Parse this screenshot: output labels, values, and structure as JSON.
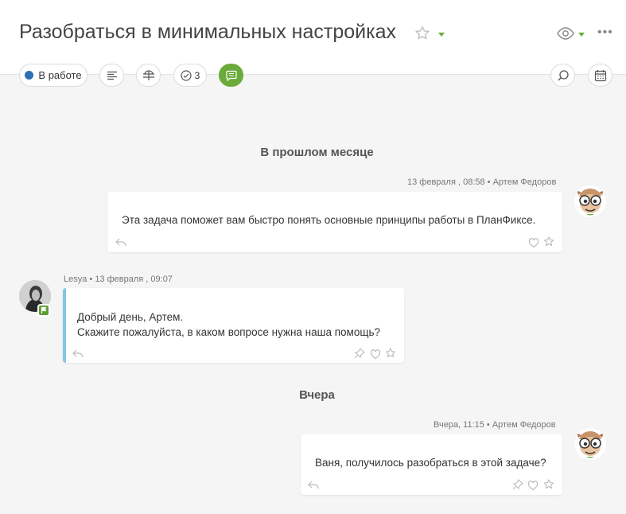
{
  "header": {
    "title": "Разобраться в минимальных настройках",
    "status_label": "В работе",
    "status_color": "#2f6db5",
    "checklist_count": "3",
    "accent_color": "#6aab3a",
    "icons": [
      "star-icon",
      "chevron-down-icon",
      "eye-icon",
      "more-icon",
      "description-icon",
      "fields-icon",
      "checklist-icon",
      "comments-icon",
      "search-icon",
      "calendar-icon"
    ]
  },
  "feed": {
    "groups": [
      {
        "label": "В прошлом месяце",
        "messages": [
          {
            "meta": "13 февраля , 08:58 • Артем Федоров",
            "lines": [
              "Эта задача поможет вам быстро понять основные принципы работы в ПланФиксе."
            ]
          },
          {
            "meta": "Lesya • 13 февраля , 09:07",
            "lines": [
              "Добрый день, Артем.",
              "Скажите пожалуйста, в каком вопросе нужна наша помощь?"
            ]
          }
        ]
      },
      {
        "label": "Вчера",
        "messages": [
          {
            "meta": "Вчера, 11:15 • Артем Федоров",
            "lines": [
              "Ваня, получилось разобраться в этой задаче?"
            ]
          }
        ]
      }
    ]
  }
}
